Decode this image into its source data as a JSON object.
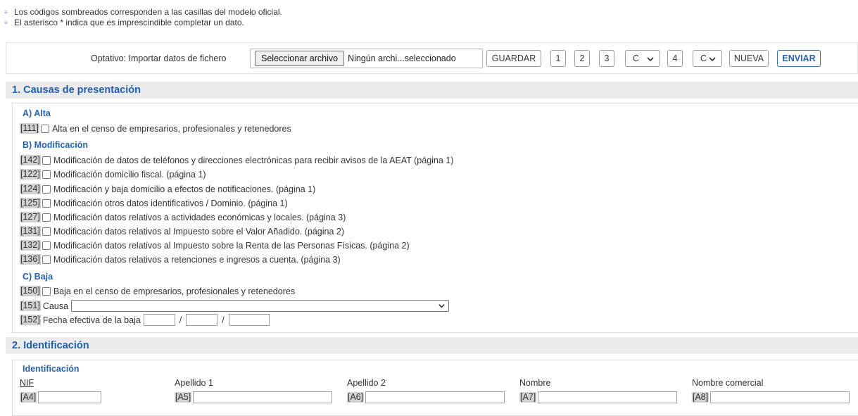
{
  "notes": [
    "Los códigos sombreados corresponden a las casillas del modelo oficial.",
    "El asterisco * indica que es imprescindible completar un dato."
  ],
  "toolbar": {
    "import_label": "Optativo: Importar datos de fichero",
    "file_button": "Seleccionar archivo",
    "file_name": "Ningún archi...seleccionado",
    "guardar": "GUARDAR",
    "page1": "1",
    "page2": "2",
    "page3": "3",
    "select1_value": "C",
    "page4": "4",
    "select2_value": "C",
    "nueva": "NUEVA",
    "enviar": "ENVIAR"
  },
  "section1": {
    "title": "1. Causas de presentación",
    "alta": {
      "title": "A) Alta",
      "items": [
        {
          "code": "[111]",
          "label": "Alta en el censo de empresarios, profesionales y retenedores"
        }
      ]
    },
    "modificacion": {
      "title": "B) Modificación",
      "items": [
        {
          "code": "[142]",
          "label": "Modificación de datos de teléfonos y direcciones electrónicas para recibir avisos de la AEAT (página 1)"
        },
        {
          "code": "[122]",
          "label": "Modificación domicilio fiscal. (página 1)"
        },
        {
          "code": "[124]",
          "label": "Modificación y baja domicilio a efectos de notificaciones. (página 1)"
        },
        {
          "code": "[125]",
          "label": "Modificación otros datos identificativos / Dominio. (página 1)"
        },
        {
          "code": "[127]",
          "label": "Modificación datos relativos a actividades económicas y locales. (página 3)"
        },
        {
          "code": "[131]",
          "label": "Modificación datos relativos al Impuesto sobre el Valor Añadido. (página 2)"
        },
        {
          "code": "[132]",
          "label": "Modificación datos relativos al Impuesto sobre la Renta de las Personas Físicas. (página 2)"
        },
        {
          "code": "[136]",
          "label": "Modificación datos relativos a retenciones e ingresos a cuenta. (página 3)"
        }
      ]
    },
    "baja": {
      "title": "C) Baja",
      "item150": {
        "code": "[150]",
        "label": "Baja en el censo de empresarios, profesionales y retenedores"
      },
      "causa": {
        "code": "[151]",
        "label": "Causa",
        "value": ""
      },
      "fecha": {
        "code": "[152]",
        "label": "Fecha efectiva de la baja",
        "sep": "/"
      }
    }
  },
  "section2": {
    "title": "2. Identificación",
    "subtitle": "Identificación",
    "fields": [
      {
        "label": "NIF",
        "code": "[A4]",
        "value": ""
      },
      {
        "label": "Apellido 1",
        "code": "[A5]",
        "value": ""
      },
      {
        "label": "Apellido 2",
        "code": "[A6]",
        "value": ""
      },
      {
        "label": "Nombre",
        "code": "[A7]",
        "value": ""
      },
      {
        "label": "Nombre comercial",
        "code": "[A8]",
        "value": ""
      }
    ]
  },
  "icons": {
    "note_bullet": "list-bullet-icon",
    "select_chevron": "chevron-down-icon"
  }
}
